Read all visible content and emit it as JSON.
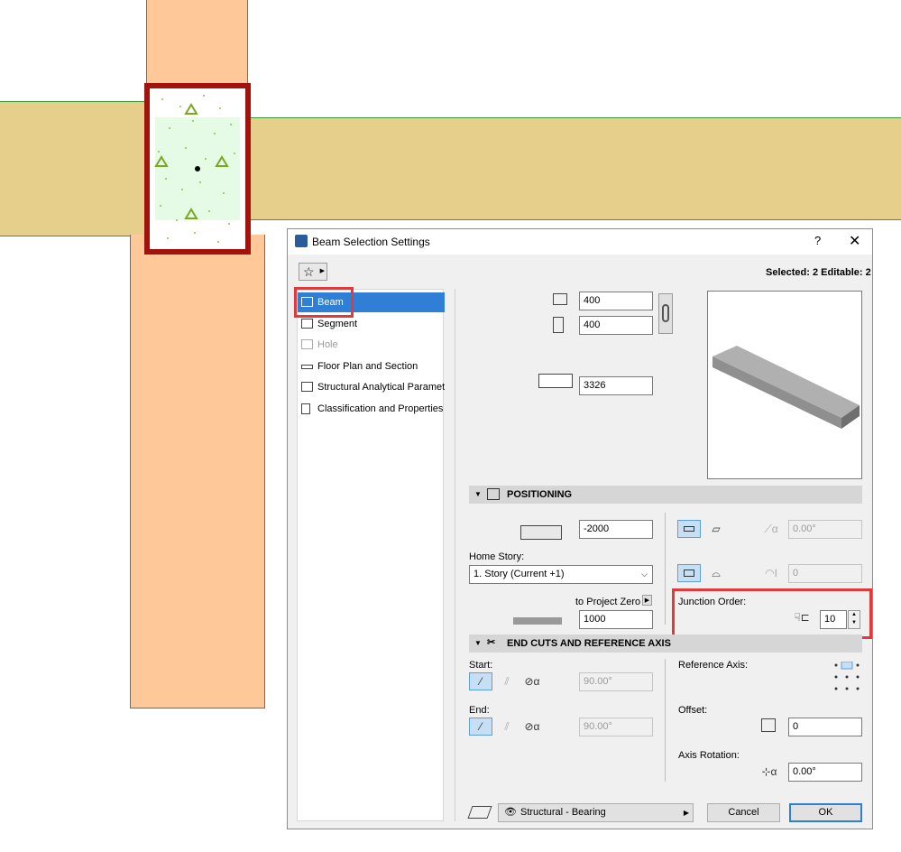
{
  "dialog": {
    "title": "Beam Selection Settings",
    "help_label": "?",
    "close_label": "✕",
    "favorites_label": "☆",
    "selected_info": "Selected: 2 Editable: 2"
  },
  "nav": {
    "items": [
      {
        "label": "Beam",
        "icon": "beam-icon",
        "state": "active"
      },
      {
        "label": "Segment",
        "icon": "segment-icon",
        "state": "normal"
      },
      {
        "label": "Hole",
        "icon": "hole-icon",
        "state": "disabled"
      },
      {
        "label": "Floor Plan and Section",
        "icon": "floor-plan-icon",
        "state": "normal"
      },
      {
        "label": "Structural Analytical Paramet…",
        "icon": "structural-analytical-icon",
        "state": "normal"
      },
      {
        "label": "Classification and Properties",
        "icon": "classification-icon",
        "state": "normal"
      }
    ]
  },
  "geometry": {
    "width": "400",
    "height": "400",
    "length": "3326"
  },
  "positioning": {
    "header": "POSITIONING",
    "offset_value": "-2000",
    "home_story_label": "Home Story:",
    "home_story_value": "1. Story (Current +1)",
    "to_project_zero_label": "to Project Zero",
    "project_zero_value": "1000",
    "tilt_angle": "0.00°",
    "curve_value": "0",
    "junction_order_label": "Junction Order:",
    "junction_order_value": "10"
  },
  "end_cuts": {
    "header": "END CUTS AND REFERENCE AXIS",
    "start_label": "Start:",
    "start_angle": "90.00°",
    "end_label": "End:",
    "end_angle": "90.00°",
    "reference_axis_label": "Reference Axis:",
    "offset_label": "Offset:",
    "offset_value": "0",
    "axis_rotation_label": "Axis Rotation:",
    "axis_rotation_value": "0.00°"
  },
  "footer": {
    "structural_function": "Structural - Bearing",
    "cancel_label": "Cancel",
    "ok_label": "OK"
  },
  "colors": {
    "column_fill": "#fec898",
    "beam_fill": "#e6cf8a",
    "selection_border": "#a3130e",
    "highlight": "#e03a3a",
    "accent": "#2f7fd6"
  }
}
